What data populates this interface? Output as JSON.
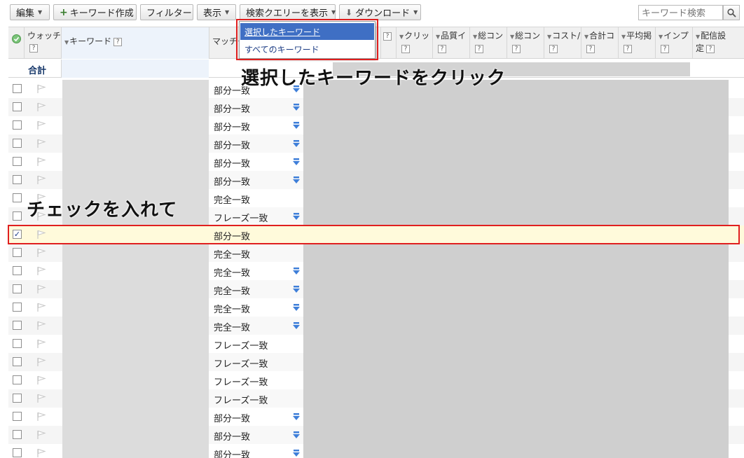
{
  "toolbar": {
    "edit_label": "編集",
    "create_label": "キーワード作成",
    "filter_label": "フィルター",
    "view_label": "表示",
    "query_label": "検索クエリーを表示",
    "download_label": "ダウンロード",
    "search_placeholder": "キーワード検索"
  },
  "query_menu": {
    "items": [
      "選択したキーワード",
      "すべてのキーワード"
    ],
    "highlighted": "選択したキーワード"
  },
  "header": {
    "watch": "ウォッチ",
    "keyword": "キーワード",
    "match": "マッチタ",
    "columns": [
      "クリッ",
      "品質イ",
      "総コン",
      "総コン",
      "コスト/",
      "合計コ",
      "平均掲",
      "インプ",
      "配信設定"
    ]
  },
  "summary": {
    "label": "合計"
  },
  "rows": [
    {
      "match": "部分一致",
      "icon": true,
      "checked": false
    },
    {
      "match": "部分一致",
      "icon": true,
      "checked": false
    },
    {
      "match": "部分一致",
      "icon": true,
      "checked": false
    },
    {
      "match": "部分一致",
      "icon": true,
      "checked": false
    },
    {
      "match": "部分一致",
      "icon": true,
      "checked": false
    },
    {
      "match": "部分一致",
      "icon": true,
      "checked": false
    },
    {
      "match": "完全一致",
      "icon": false,
      "checked": false
    },
    {
      "match": "フレーズ一致",
      "icon": true,
      "checked": false
    },
    {
      "match": "部分一致",
      "icon": false,
      "checked": true
    },
    {
      "match": "完全一致",
      "icon": false,
      "checked": false
    },
    {
      "match": "完全一致",
      "icon": true,
      "checked": false
    },
    {
      "match": "完全一致",
      "icon": true,
      "checked": false
    },
    {
      "match": "完全一致",
      "icon": true,
      "checked": false
    },
    {
      "match": "完全一致",
      "icon": true,
      "checked": false
    },
    {
      "match": "フレーズ一致",
      "icon": false,
      "checked": false
    },
    {
      "match": "フレーズ一致",
      "icon": false,
      "checked": false
    },
    {
      "match": "フレーズ一致",
      "icon": false,
      "checked": false
    },
    {
      "match": "フレーズ一致",
      "icon": false,
      "checked": false
    },
    {
      "match": "部分一致",
      "icon": true,
      "checked": false
    },
    {
      "match": "部分一致",
      "icon": true,
      "checked": false
    },
    {
      "match": "部分一致",
      "icon": true,
      "checked": false
    }
  ],
  "annotations": {
    "click_text": "選択したキーワードをクリック",
    "check_text": "チェックを入れて",
    "box_color": "#e01f1f"
  },
  "colors": {
    "menu_highlight": "#3f6fc4",
    "selected_row": "#fffadb",
    "match_icon": "#3f7fd9"
  }
}
